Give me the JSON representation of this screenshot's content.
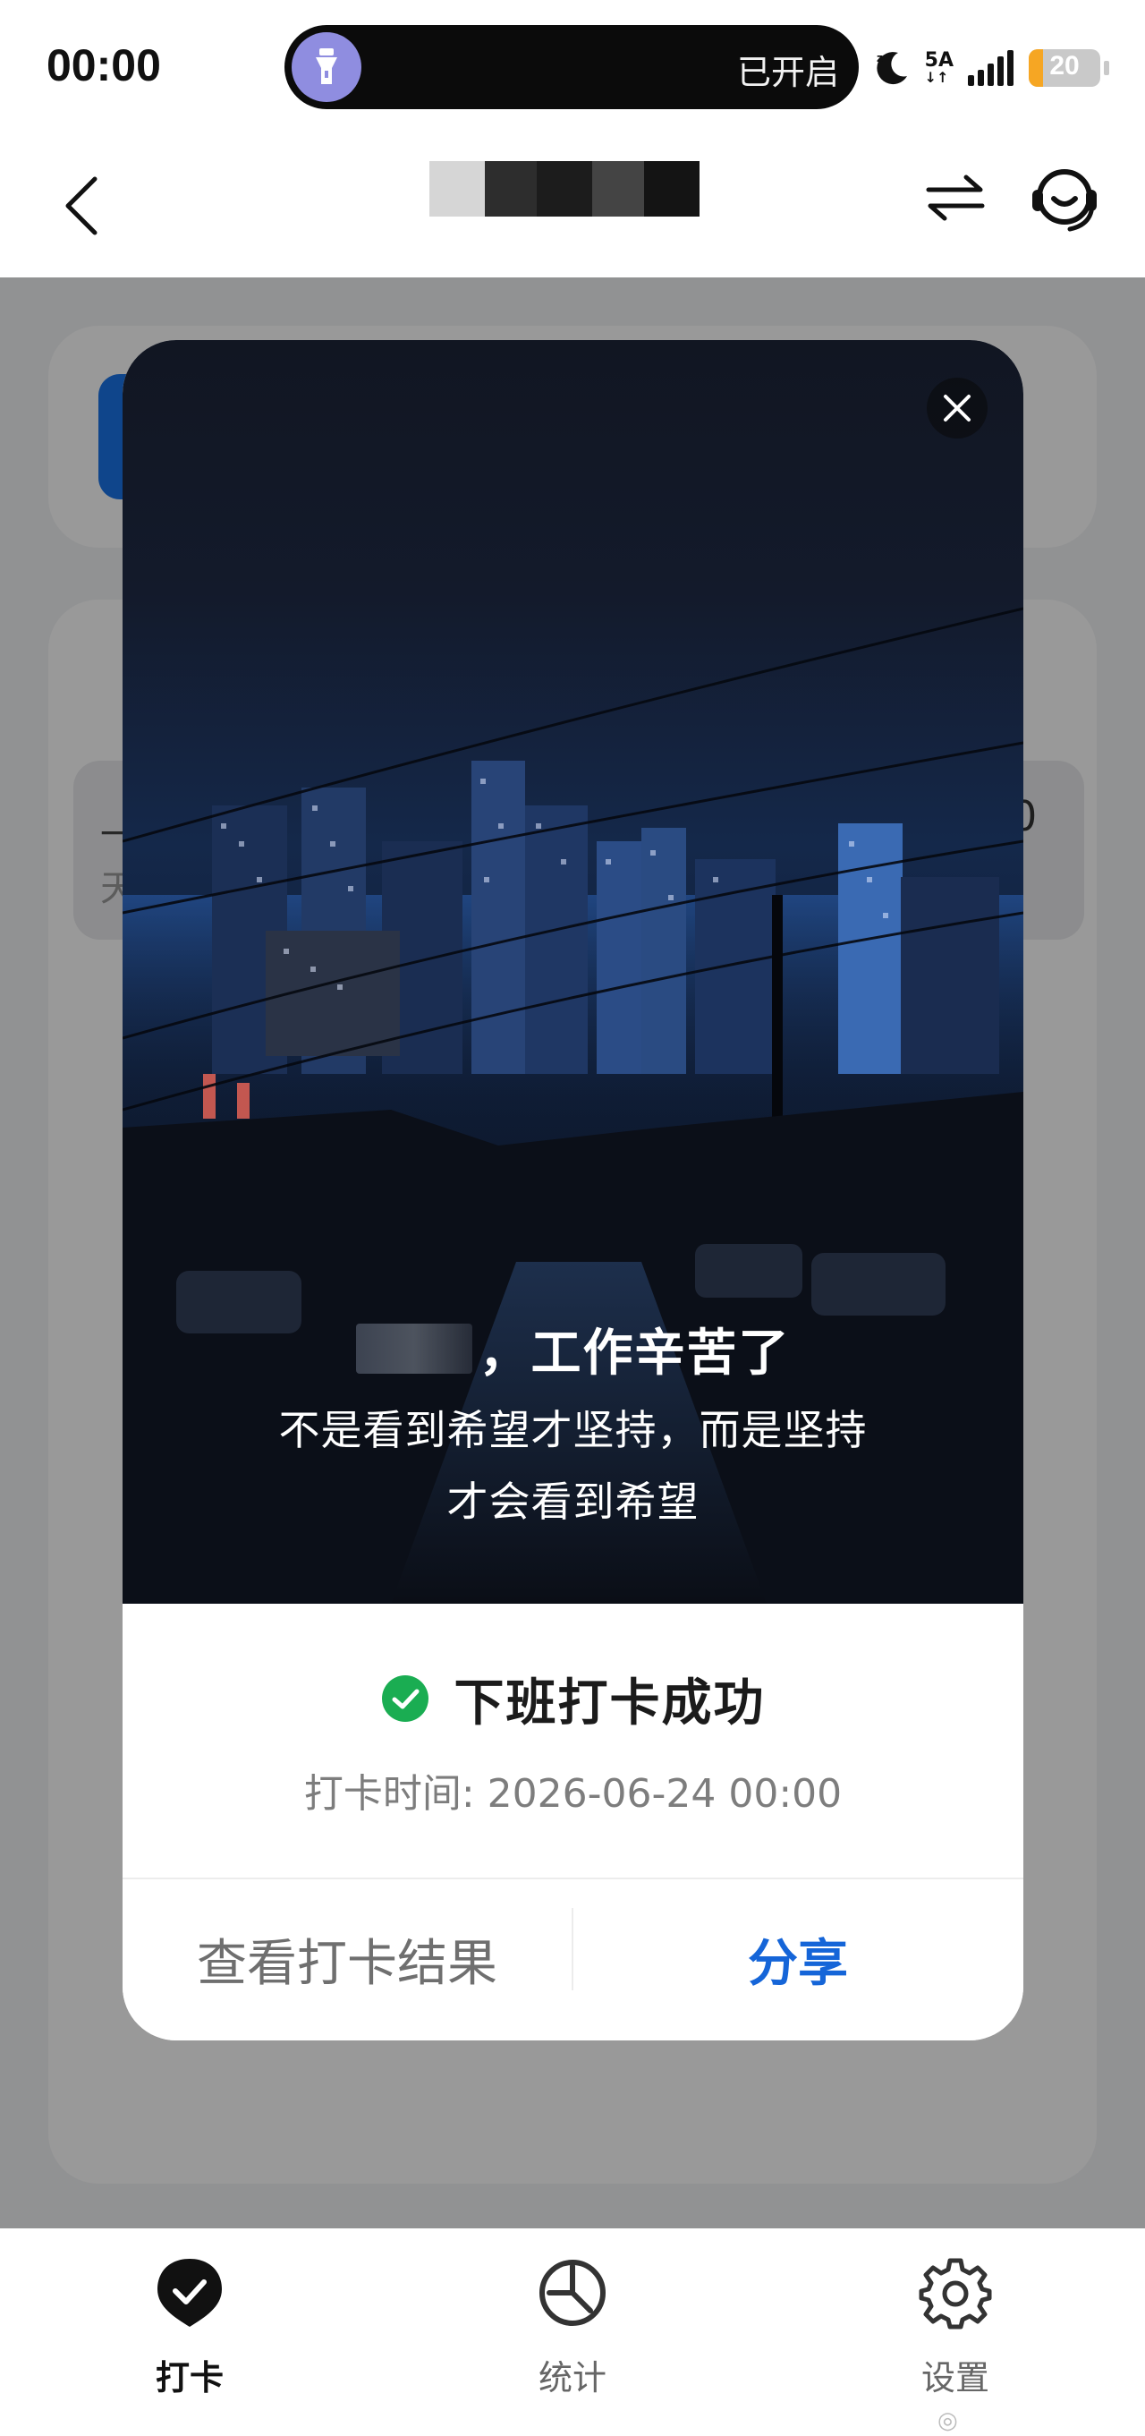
{
  "status_bar": {
    "time": "00:00",
    "island_text": "已开启",
    "network_label": "5A",
    "battery_level": 20,
    "battery_text": "20"
  },
  "header": {
    "icons": [
      "back-icon",
      "swap-icon",
      "headset-icon"
    ]
  },
  "background_page": {
    "row_left_text": "一",
    "row_left_subtext": "天",
    "row_right_text": "0"
  },
  "dialog": {
    "greeting": "，工作辛苦了",
    "motto_line1": "不是看到希望才坚持，而是坚持",
    "motto_line2": "才会看到希望",
    "result_title": "下班打卡成功",
    "result_time": "打卡时间: 2026-06-24 00:00",
    "view_result_button": "查看打卡结果",
    "share_button": "分享"
  },
  "bottom_nav": {
    "items": [
      {
        "label": "打卡",
        "icon": "checkin-icon",
        "active": true
      },
      {
        "label": "统计",
        "icon": "stats-icon",
        "active": false
      },
      {
        "label": "设置",
        "icon": "gear-icon",
        "active": false
      }
    ]
  },
  "colors": {
    "accent": "#1565d8",
    "success": "#1aad52",
    "battery": "#f6a623"
  }
}
